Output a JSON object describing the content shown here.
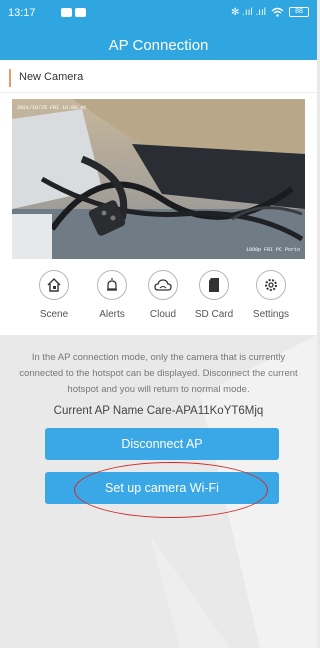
{
  "status_bar": {
    "time": "13:17",
    "signal_text": "✻ .ııl .ııl",
    "wifi_icon": "wifi-icon",
    "battery": "88"
  },
  "header": {
    "title": "AP Connection"
  },
  "device": {
    "name": "New Camera"
  },
  "video": {
    "osd_timestamp": "2021/10/25  FRI 16:08:46",
    "osd_watermark": "1080p  FRI  PC  Porto"
  },
  "toolbar": {
    "items": [
      {
        "label": "Scene",
        "icon": "home-icon"
      },
      {
        "label": "Alerts",
        "icon": "bell-icon"
      },
      {
        "label": "Cloud",
        "icon": "cloud-icon"
      },
      {
        "label": "SD Card",
        "icon": "sd-card-icon"
      },
      {
        "label": "Settings",
        "icon": "gear-icon"
      }
    ]
  },
  "info": {
    "line1": "In the AP connection mode, only the camera that is currently",
    "line2": "connected to the hotspot can be displayed. Disconnect the current",
    "line3": "hotspot and you will return to normal mode.",
    "ap_name": "Current AP Name Care-APA11KoYT6Mjq"
  },
  "buttons": {
    "disconnect": "Disconnect AP",
    "setup": "Set up camera Wi-Fi"
  },
  "colors": {
    "header_bg": "#2fa6e0",
    "button_bg": "#3aa8e6",
    "annotation": "#d42a2a",
    "accent_bar": "#e99b68"
  }
}
